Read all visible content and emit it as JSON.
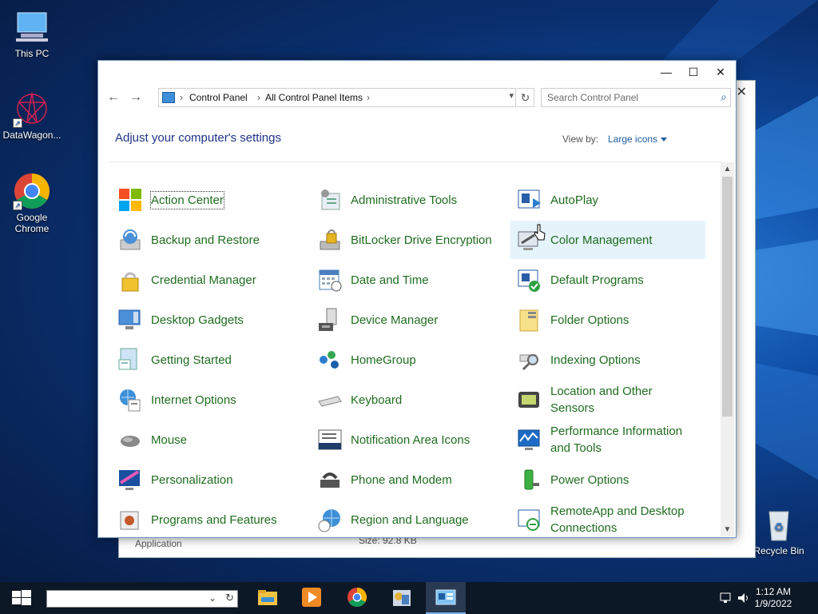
{
  "desktop": {
    "icons": [
      {
        "label": "This PC",
        "icon": "computer-icon"
      },
      {
        "label": "DataWagon...",
        "icon": "datawagon-icon"
      },
      {
        "label": "Google Chrome",
        "icon": "chrome-icon"
      },
      {
        "label": "Recycle Bin",
        "icon": "recycle-bin-icon"
      }
    ]
  },
  "back_window": {
    "app_text": "Application",
    "size_text": "Size: 92.8 KB"
  },
  "window": {
    "controls": {
      "minimize": "—",
      "maximize": "☐",
      "close": "✕"
    },
    "nav": {
      "back": "←",
      "forward": "→"
    },
    "breadcrumb": [
      "Control Panel",
      "All Control Panel Items"
    ],
    "search_placeholder": "Search Control Panel",
    "heading": "Adjust your computer's settings",
    "view_by_label": "View by:",
    "view_by_value": "Large icons",
    "items": [
      {
        "label": "Action Center",
        "icon": "action-center-icon"
      },
      {
        "label": "Administrative Tools",
        "icon": "administrative-tools-icon"
      },
      {
        "label": "AutoPlay",
        "icon": "autoplay-icon"
      },
      {
        "label": "Backup and Restore",
        "icon": "backup-restore-icon"
      },
      {
        "label": "BitLocker Drive Encryption",
        "icon": "bitlocker-icon"
      },
      {
        "label": "Color Management",
        "icon": "color-management-icon"
      },
      {
        "label": "Credential Manager",
        "icon": "credential-manager-icon"
      },
      {
        "label": "Date and Time",
        "icon": "date-time-icon"
      },
      {
        "label": "Default Programs",
        "icon": "default-programs-icon"
      },
      {
        "label": "Desktop Gadgets",
        "icon": "desktop-gadgets-icon"
      },
      {
        "label": "Device Manager",
        "icon": "device-manager-icon"
      },
      {
        "label": "Folder Options",
        "icon": "folder-options-icon"
      },
      {
        "label": "Getting Started",
        "icon": "getting-started-icon"
      },
      {
        "label": "HomeGroup",
        "icon": "homegroup-icon"
      },
      {
        "label": "Indexing Options",
        "icon": "indexing-options-icon"
      },
      {
        "label": "Internet Options",
        "icon": "internet-options-icon"
      },
      {
        "label": "Keyboard",
        "icon": "keyboard-icon"
      },
      {
        "label": "Location and Other Sensors",
        "icon": "location-sensors-icon"
      },
      {
        "label": "Mouse",
        "icon": "mouse-icon"
      },
      {
        "label": "Notification Area Icons",
        "icon": "notification-area-icon"
      },
      {
        "label": "Performance Information and Tools",
        "icon": "performance-icon"
      },
      {
        "label": "Personalization",
        "icon": "personalization-icon"
      },
      {
        "label": "Phone and Modem",
        "icon": "phone-modem-icon"
      },
      {
        "label": "Power Options",
        "icon": "power-options-icon"
      },
      {
        "label": "Programs and Features",
        "icon": "programs-features-icon"
      },
      {
        "label": "Region and Language",
        "icon": "region-language-icon"
      },
      {
        "label": "RemoteApp and Desktop Connections",
        "icon": "remoteapp-icon"
      }
    ],
    "scroll_up": "▲",
    "scroll_down": "▼"
  },
  "taskbar": {
    "apps": [
      "file-explorer-icon",
      "media-player-icon",
      "chrome-icon",
      "app-icon",
      "control-panel-icon"
    ],
    "time": "1:12 AM",
    "date": "1/9/2022"
  }
}
